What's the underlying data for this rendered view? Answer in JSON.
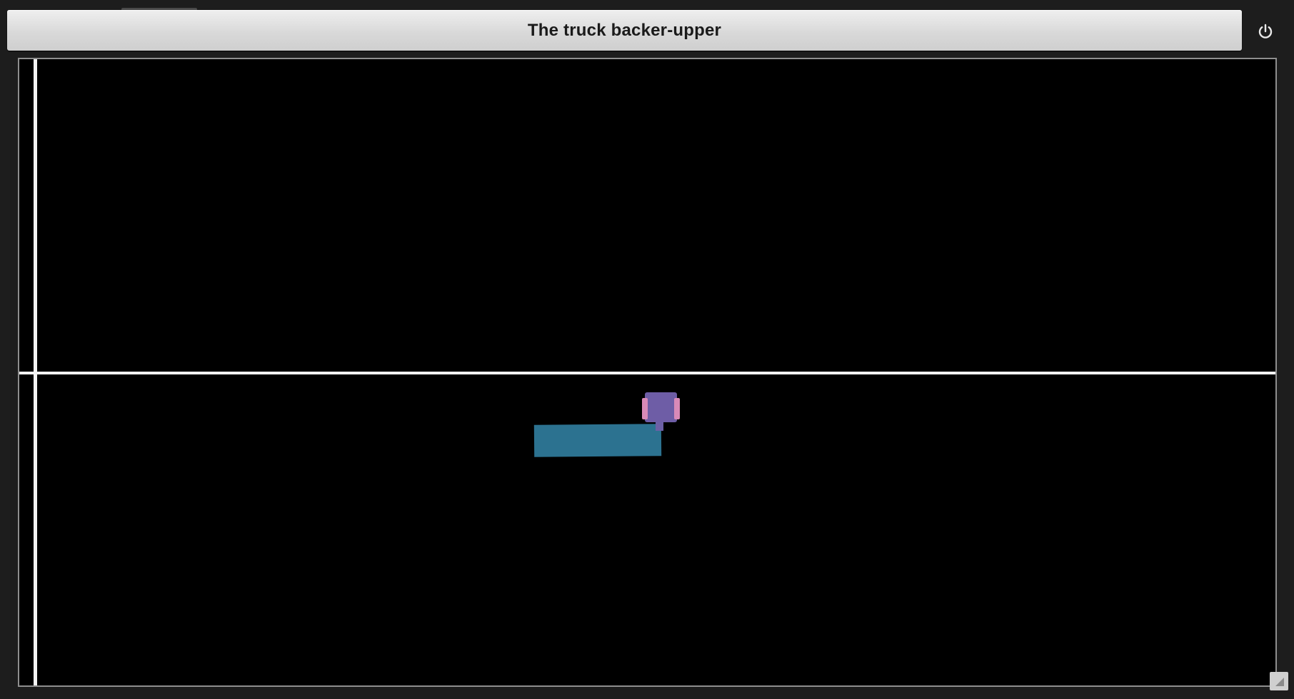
{
  "window": {
    "title": "The truck backer-upper"
  },
  "icons": {
    "power": "power-icon",
    "resize": "resize-grip-icon"
  },
  "colors": {
    "trailer": "#2c7290",
    "cab": "#6e5da6",
    "wheels": "#d98ab8",
    "guide_lines": "#f4f4f4",
    "canvas_bg": "#000000"
  }
}
